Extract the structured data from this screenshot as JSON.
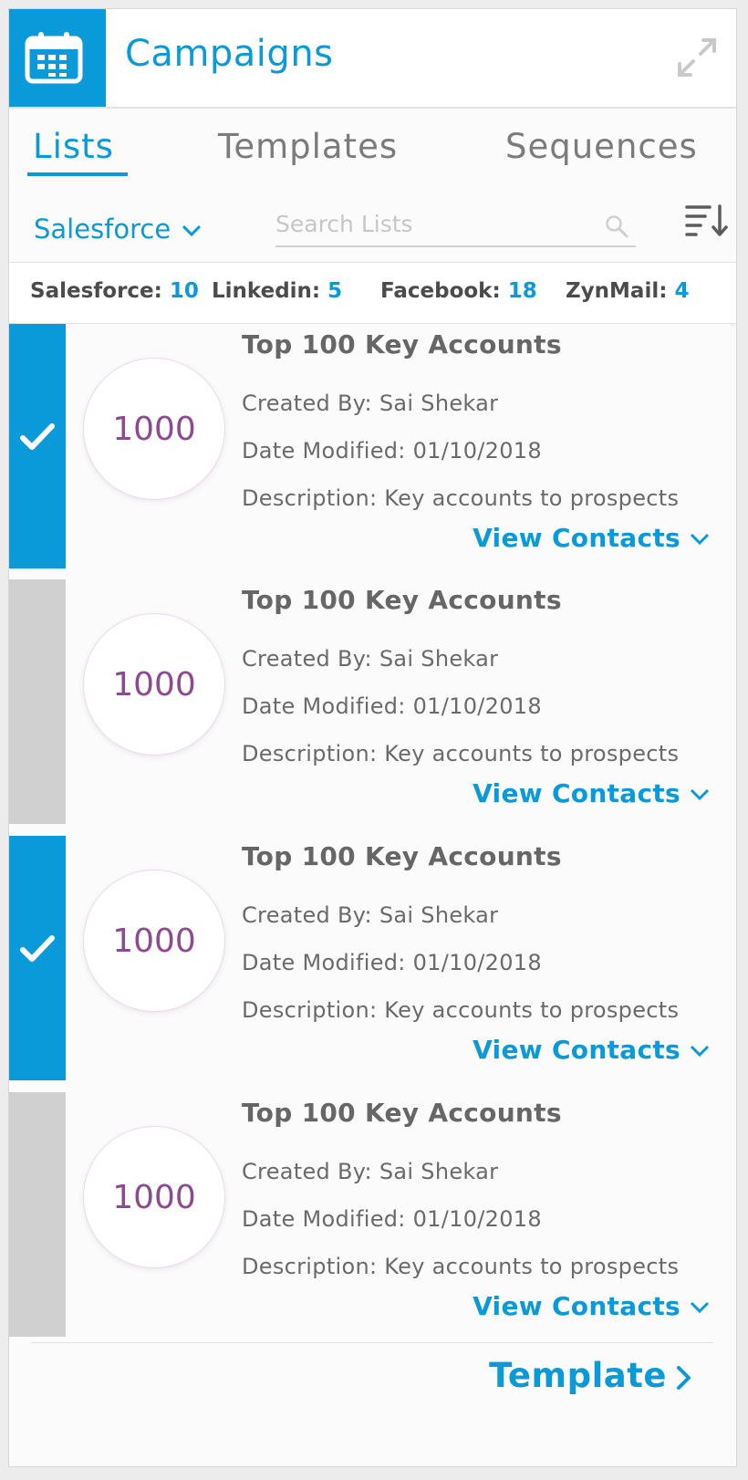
{
  "header": {
    "title": "Campaigns",
    "logo_icon": "calendar-icon",
    "expand_icon": "expand-icon",
    "brand_color": "#0a9ad9"
  },
  "tabs": [
    {
      "label": "Lists",
      "active": true
    },
    {
      "label": "Templates",
      "active": false
    },
    {
      "label": "Sequences",
      "active": false
    }
  ],
  "filter": {
    "source": "Salesforce",
    "search_placeholder": "Search Lists",
    "search_value": ""
  },
  "counts": [
    {
      "label": "Salesforce:",
      "value": "10"
    },
    {
      "label": "Linkedin:",
      "value": "5"
    },
    {
      "label": "Facebook:",
      "value": "18"
    },
    {
      "label": "ZynMail:",
      "value": "4"
    }
  ],
  "lists": [
    {
      "selected": true,
      "count": "1000",
      "title": "Top 100 Key Accounts",
      "created_by": "Created By: Sai Shekar",
      "date_modified": "Date Modified: 01/10/2018",
      "description": "Description: Key accounts to prospects",
      "action": "View Contacts"
    },
    {
      "selected": false,
      "count": "1000",
      "title": "Top 100 Key Accounts",
      "created_by": "Created By: Sai Shekar",
      "date_modified": "Date Modified: 01/10/2018",
      "description": "Description: Key accounts to prospects",
      "action": "View Contacts"
    },
    {
      "selected": true,
      "count": "1000",
      "title": "Top 100 Key Accounts",
      "created_by": "Created By: Sai Shekar",
      "date_modified": "Date Modified: 01/10/2018",
      "description": "Description: Key accounts to prospects",
      "action": "View Contacts"
    },
    {
      "selected": false,
      "count": "1000",
      "title": "Top 100 Key Accounts",
      "created_by": "Created By: Sai Shekar",
      "date_modified": "Date Modified: 01/10/2018",
      "description": "Description: Key accounts to prospects",
      "action": "View Contacts"
    }
  ],
  "footer": {
    "template_label": "Template"
  }
}
